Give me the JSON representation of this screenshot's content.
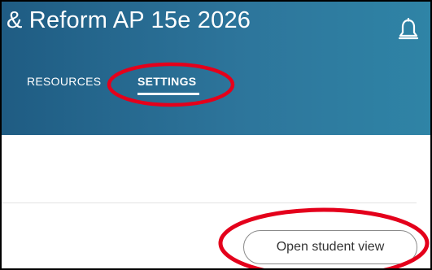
{
  "header": {
    "course_title": "& Reform AP 15e 2026",
    "notifications_icon": "bell-icon",
    "background_color": "#2a6e95"
  },
  "tabs": [
    {
      "label": "RESOURCES",
      "active": false
    },
    {
      "label": "SETTINGS",
      "active": true
    }
  ],
  "actions": {
    "open_student_view_label": "Open student view"
  },
  "annotations": {
    "highlight_color": "#e4001b"
  }
}
